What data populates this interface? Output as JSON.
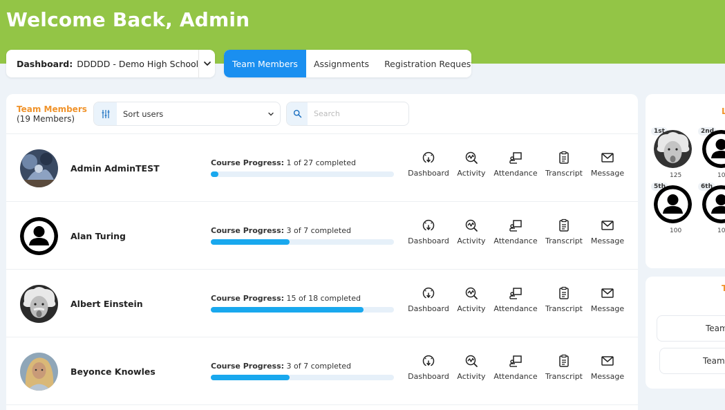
{
  "header": {
    "welcome": "Welcome Back, Admin"
  },
  "dashboard_select": {
    "label": "Dashboard:",
    "value": "DDDDD - Demo High School"
  },
  "tabs": [
    {
      "label": "Team Members",
      "active": true
    },
    {
      "label": "Assignments",
      "active": false
    },
    {
      "label": "Registration Requests",
      "active": false
    }
  ],
  "team": {
    "title": "Team Members",
    "count": "(19 Members)",
    "sort_label": "Sort users",
    "search_placeholder": "Search"
  },
  "progress_label": "Course Progress:",
  "actions": [
    "Dashboard",
    "Activity",
    "Attendance",
    "Transcript",
    "Message"
  ],
  "members": [
    {
      "name": "Admin AdminTEST",
      "progress_text": "1 of 27 completed",
      "completed": 1,
      "total": 27
    },
    {
      "name": "Alan Turing",
      "progress_text": "3 of 7 completed",
      "completed": 3,
      "total": 7
    },
    {
      "name": "Albert Einstein",
      "progress_text": "15 of 18 completed",
      "completed": 15,
      "total": 18
    },
    {
      "name": "Beyonce Knowles",
      "progress_text": "3 of 7 completed",
      "completed": 3,
      "total": 7
    }
  ],
  "leaderboard": {
    "title_partial": "L",
    "entries": [
      {
        "rank": "1st",
        "score": "125"
      },
      {
        "rank": "2nd",
        "score": "10"
      },
      {
        "rank": "5th",
        "score": "100"
      },
      {
        "rank": "6th",
        "score": "10"
      }
    ]
  },
  "right_panel_2": {
    "title_partial": "T",
    "buttons": [
      "Team",
      "Team l"
    ]
  },
  "colors": {
    "banner": "#93c546",
    "accent": "#1a8ff0",
    "orange": "#f0932b",
    "progress": "#19a8ee"
  }
}
